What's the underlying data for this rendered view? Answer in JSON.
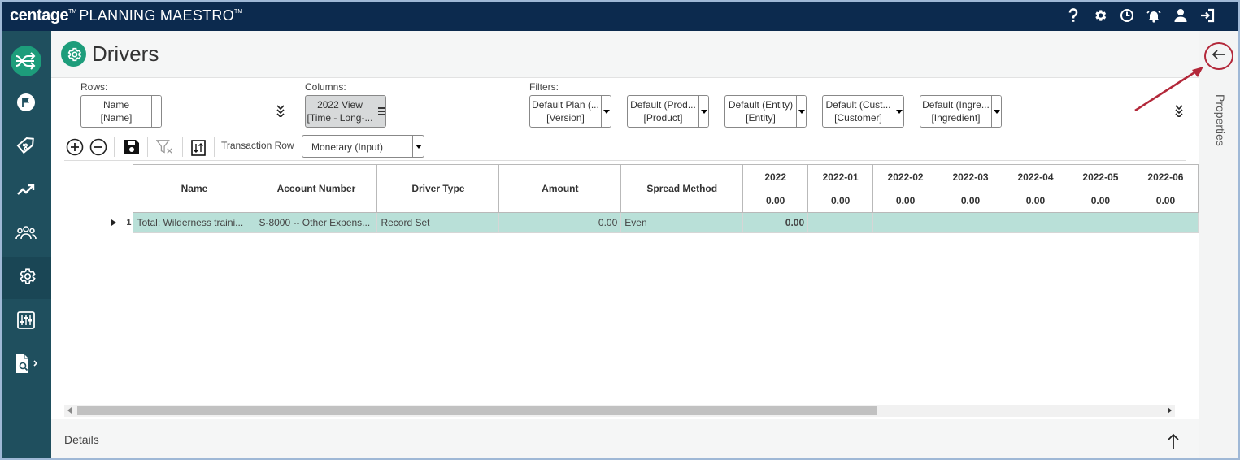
{
  "app": {
    "brand_bold": "centage",
    "brand_tm": "TM",
    "brand_name": "PLANNING MAESTRO",
    "brand_name_tm": "TM"
  },
  "topbar": {
    "icons": [
      "help-icon",
      "gear-icon",
      "clock-icon",
      "alarm-bell-icon",
      "user-icon",
      "logout-icon"
    ]
  },
  "sidebar": {
    "items": [
      {
        "name": "logo-icon"
      },
      {
        "name": "flag-icon"
      },
      {
        "name": "budget-tag-icon"
      },
      {
        "name": "trend-chart-icon"
      },
      {
        "name": "users-group-icon"
      },
      {
        "name": "settings-gear-icon",
        "active": true
      },
      {
        "name": "sliders-icon"
      },
      {
        "name": "report-document-icon"
      }
    ]
  },
  "page": {
    "title": "Drivers"
  },
  "pivot": {
    "rows_label": "Rows:",
    "rows_value": {
      "line1": "Name",
      "line2": "[Name]"
    },
    "columns_label": "Columns:",
    "columns_value": {
      "line1": "2022 View",
      "line2": "[Time - Long-..."
    },
    "filters_label": "Filters:",
    "filters": [
      {
        "line1": "Default Plan (...",
        "line2": "[Version]"
      },
      {
        "line1": "Default (Prod...",
        "line2": "[Product]"
      },
      {
        "line1": "Default (Entity)",
        "line2": "[Entity]"
      },
      {
        "line1": "Default (Cust...",
        "line2": "[Customer]"
      },
      {
        "line1": "Default (Ingre...",
        "line2": "[Ingredient]"
      }
    ]
  },
  "toolbar": {
    "transaction_row_label": "Transaction Row",
    "transaction_row_value": "Monetary (Input)"
  },
  "grid": {
    "columns": [
      "Name",
      "Account Number",
      "Driver Type",
      "Amount",
      "Spread Method"
    ],
    "periods": [
      "2022",
      "2022-01",
      "2022-02",
      "2022-03",
      "2022-04",
      "2022-05",
      "2022-06"
    ],
    "period_totals": [
      "0.00",
      "0.00",
      "0.00",
      "0.00",
      "0.00",
      "0.00",
      "0.00"
    ],
    "rows": [
      {
        "index": "1",
        "name": "Total: Wilderness traini...",
        "account": "S-8000 -- Other Expens...",
        "driver_type": "Record Set",
        "amount": "0.00",
        "spread": "Even",
        "periods": [
          "0.00",
          "",
          "",
          "",
          "",
          "",
          ""
        ]
      }
    ]
  },
  "details": {
    "label": "Details"
  },
  "right_panel": {
    "label": "Properties"
  },
  "colors": {
    "topbar": "#0c2a4e",
    "sidebar": "#1f4f5e",
    "accent": "#1d9d7b",
    "row_highlight": "#b9e0d8",
    "annotation": "#b3283a"
  }
}
